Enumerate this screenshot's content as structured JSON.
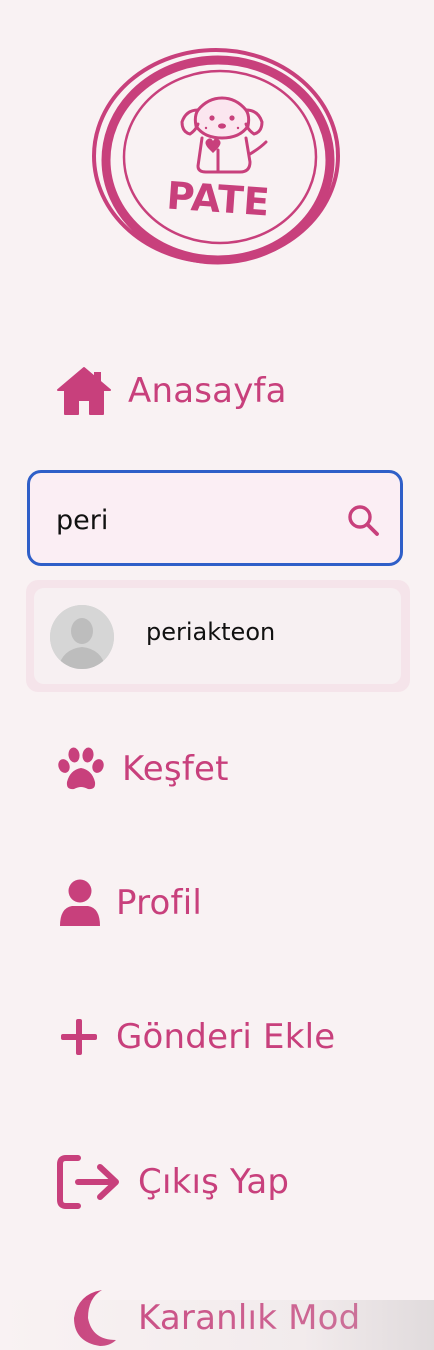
{
  "brand": {
    "logo_text": "PATE",
    "accent_color": "#c8407c"
  },
  "nav": {
    "home": {
      "label": "Anasayfa",
      "icon": "home-icon"
    },
    "explore": {
      "label": "Keşfet",
      "icon": "paw-icon"
    },
    "profile": {
      "label": "Profil",
      "icon": "user-icon"
    },
    "add_post": {
      "label": "Gönderi Ekle",
      "icon": "plus-icon"
    },
    "logout": {
      "label": "Çıkış Yap",
      "icon": "logout-icon"
    },
    "dark_mode": {
      "label": "Karanlık Mod",
      "icon": "moon-icon"
    }
  },
  "search": {
    "value": "peri",
    "icon": "search-icon",
    "results": [
      {
        "username": "periakteon",
        "avatar": "default-avatar"
      }
    ]
  }
}
